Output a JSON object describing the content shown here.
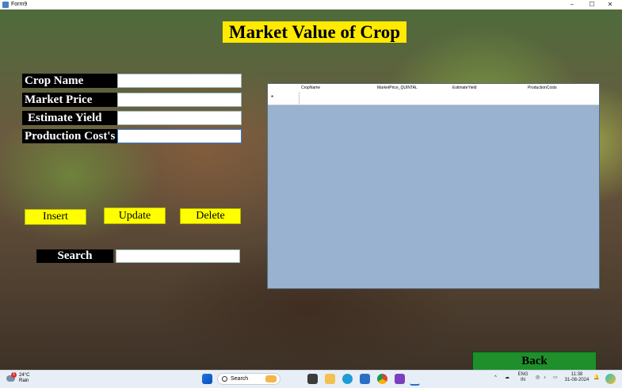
{
  "window": {
    "title": "Form9",
    "controls": [
      "–",
      "☐",
      "✕"
    ]
  },
  "heading": "Market Value of Crop",
  "form": {
    "crop_name_label": "Crop Name",
    "market_price_label": "Market Price",
    "estimate_yield_label": "Estimate Yield",
    "production_cost_label": "Production Cost's",
    "crop_name_value": "",
    "market_price_value": "",
    "estimate_yield_value": "",
    "production_cost_value": ""
  },
  "buttons": {
    "insert": "Insert",
    "update": "Update",
    "delete": "Delete",
    "back": "Back"
  },
  "search": {
    "label": "Search",
    "value": ""
  },
  "grid": {
    "columns": [
      "CropName",
      "MarketPrice_QUINTAL",
      "EstimateYield",
      "ProductionCosts"
    ],
    "new_row_marker": "*"
  },
  "taskbar": {
    "weather_temp": "24°C",
    "weather_desc": "Rain",
    "weather_badge": "1",
    "search_placeholder": "Search",
    "lang_top": "ENG",
    "lang_bottom": "IN",
    "time": "11:38",
    "date": "31-08-2024"
  },
  "colors": {
    "heading_bg": "#ffea00",
    "button_bg": "#ffff00",
    "back_bg": "#1f8f2c",
    "grid_bg": "#98b2d0"
  }
}
